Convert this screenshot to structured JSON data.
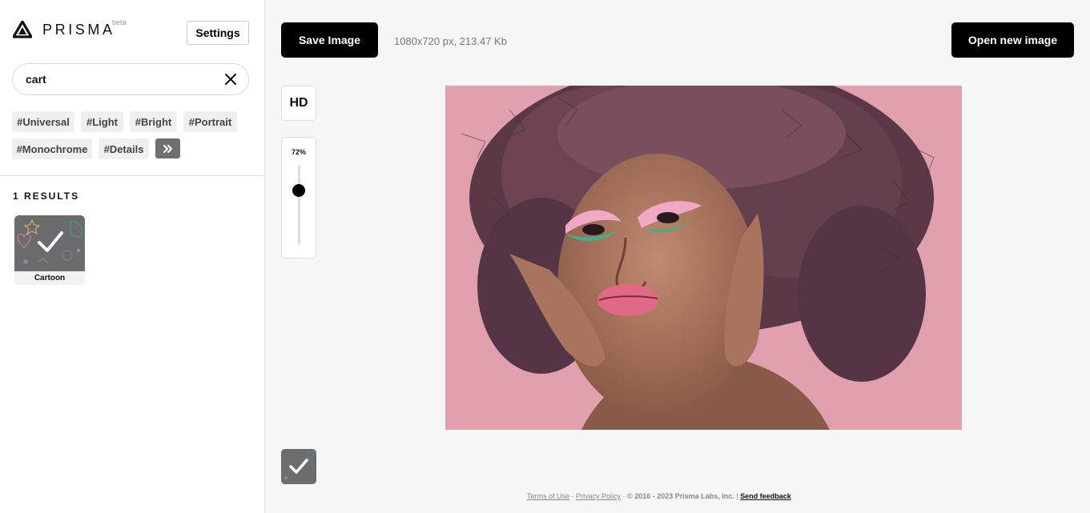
{
  "app": {
    "logo_text": "PRISMA",
    "beta_label": "beta",
    "settings_label": "Settings"
  },
  "search": {
    "value": "cart",
    "clear_icon": "close-icon"
  },
  "tags": [
    "#Universal",
    "#Light",
    "#Bright",
    "#Portrait",
    "#Monochrome",
    "#Details"
  ],
  "more_tags_icon": "double-chevron-right-icon",
  "results": {
    "title": "1 RESULTS",
    "items": [
      {
        "name": "Cartoon",
        "selected": true
      }
    ]
  },
  "toolbar": {
    "save_label": "Save Image",
    "image_info": "1080x720 px, 213.47 Kb",
    "open_label": "Open new image"
  },
  "controls": {
    "hd_label": "HD",
    "intensity_label": "72%",
    "intensity": 0.72
  },
  "footer": {
    "terms": "Terms of Use",
    "sep1": "·",
    "privacy": "Privacy Policy",
    "sep2": "·",
    "copyright": "© 2016 - 2023 Prisma Labs, Inc.",
    "sep3": "|",
    "feedback": "Send feedback"
  },
  "colors": {
    "accent": "#000000",
    "tag_bg": "#efefef",
    "more_tag_bg": "#6f6f6f",
    "canvas_bg": "#e0a0ae"
  }
}
